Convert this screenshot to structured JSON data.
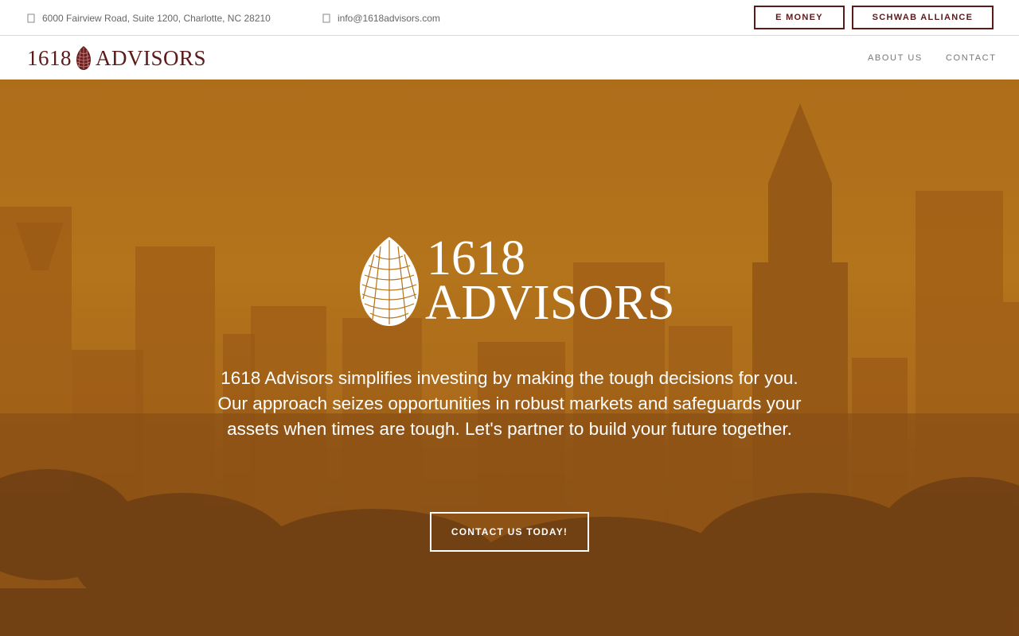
{
  "topbar": {
    "address": "6000 Fairview Road, Suite 1200, Charlotte, NC 28210",
    "email": "info@1618advisors.com",
    "buttons": {
      "emoney": "E MONEY",
      "schwab": "SCHWAB ALLIANCE"
    },
    "address_icon": "map-marker-icon",
    "email_icon": "envelope-icon"
  },
  "header": {
    "logo": {
      "number": "1618",
      "word": "ADVISORS",
      "icon": "pinecone-icon"
    },
    "nav": {
      "about": "ABOUT US",
      "contact": "CONTACT"
    }
  },
  "hero": {
    "brand_line_1": "1618",
    "brand_line_2": "ADVISORS",
    "tagline": "1618 Advisors simplifies investing by making the tough decisions for you. Our approach seizes opportunities in robust markets and safeguards your assets when times are tough. Let's partner to build your future together.",
    "cta": "CONTACT US TODAY!"
  },
  "colors": {
    "brand": "#5c1a1a",
    "hero_tint": "#ac6c1a",
    "nav_text": "#777777"
  }
}
